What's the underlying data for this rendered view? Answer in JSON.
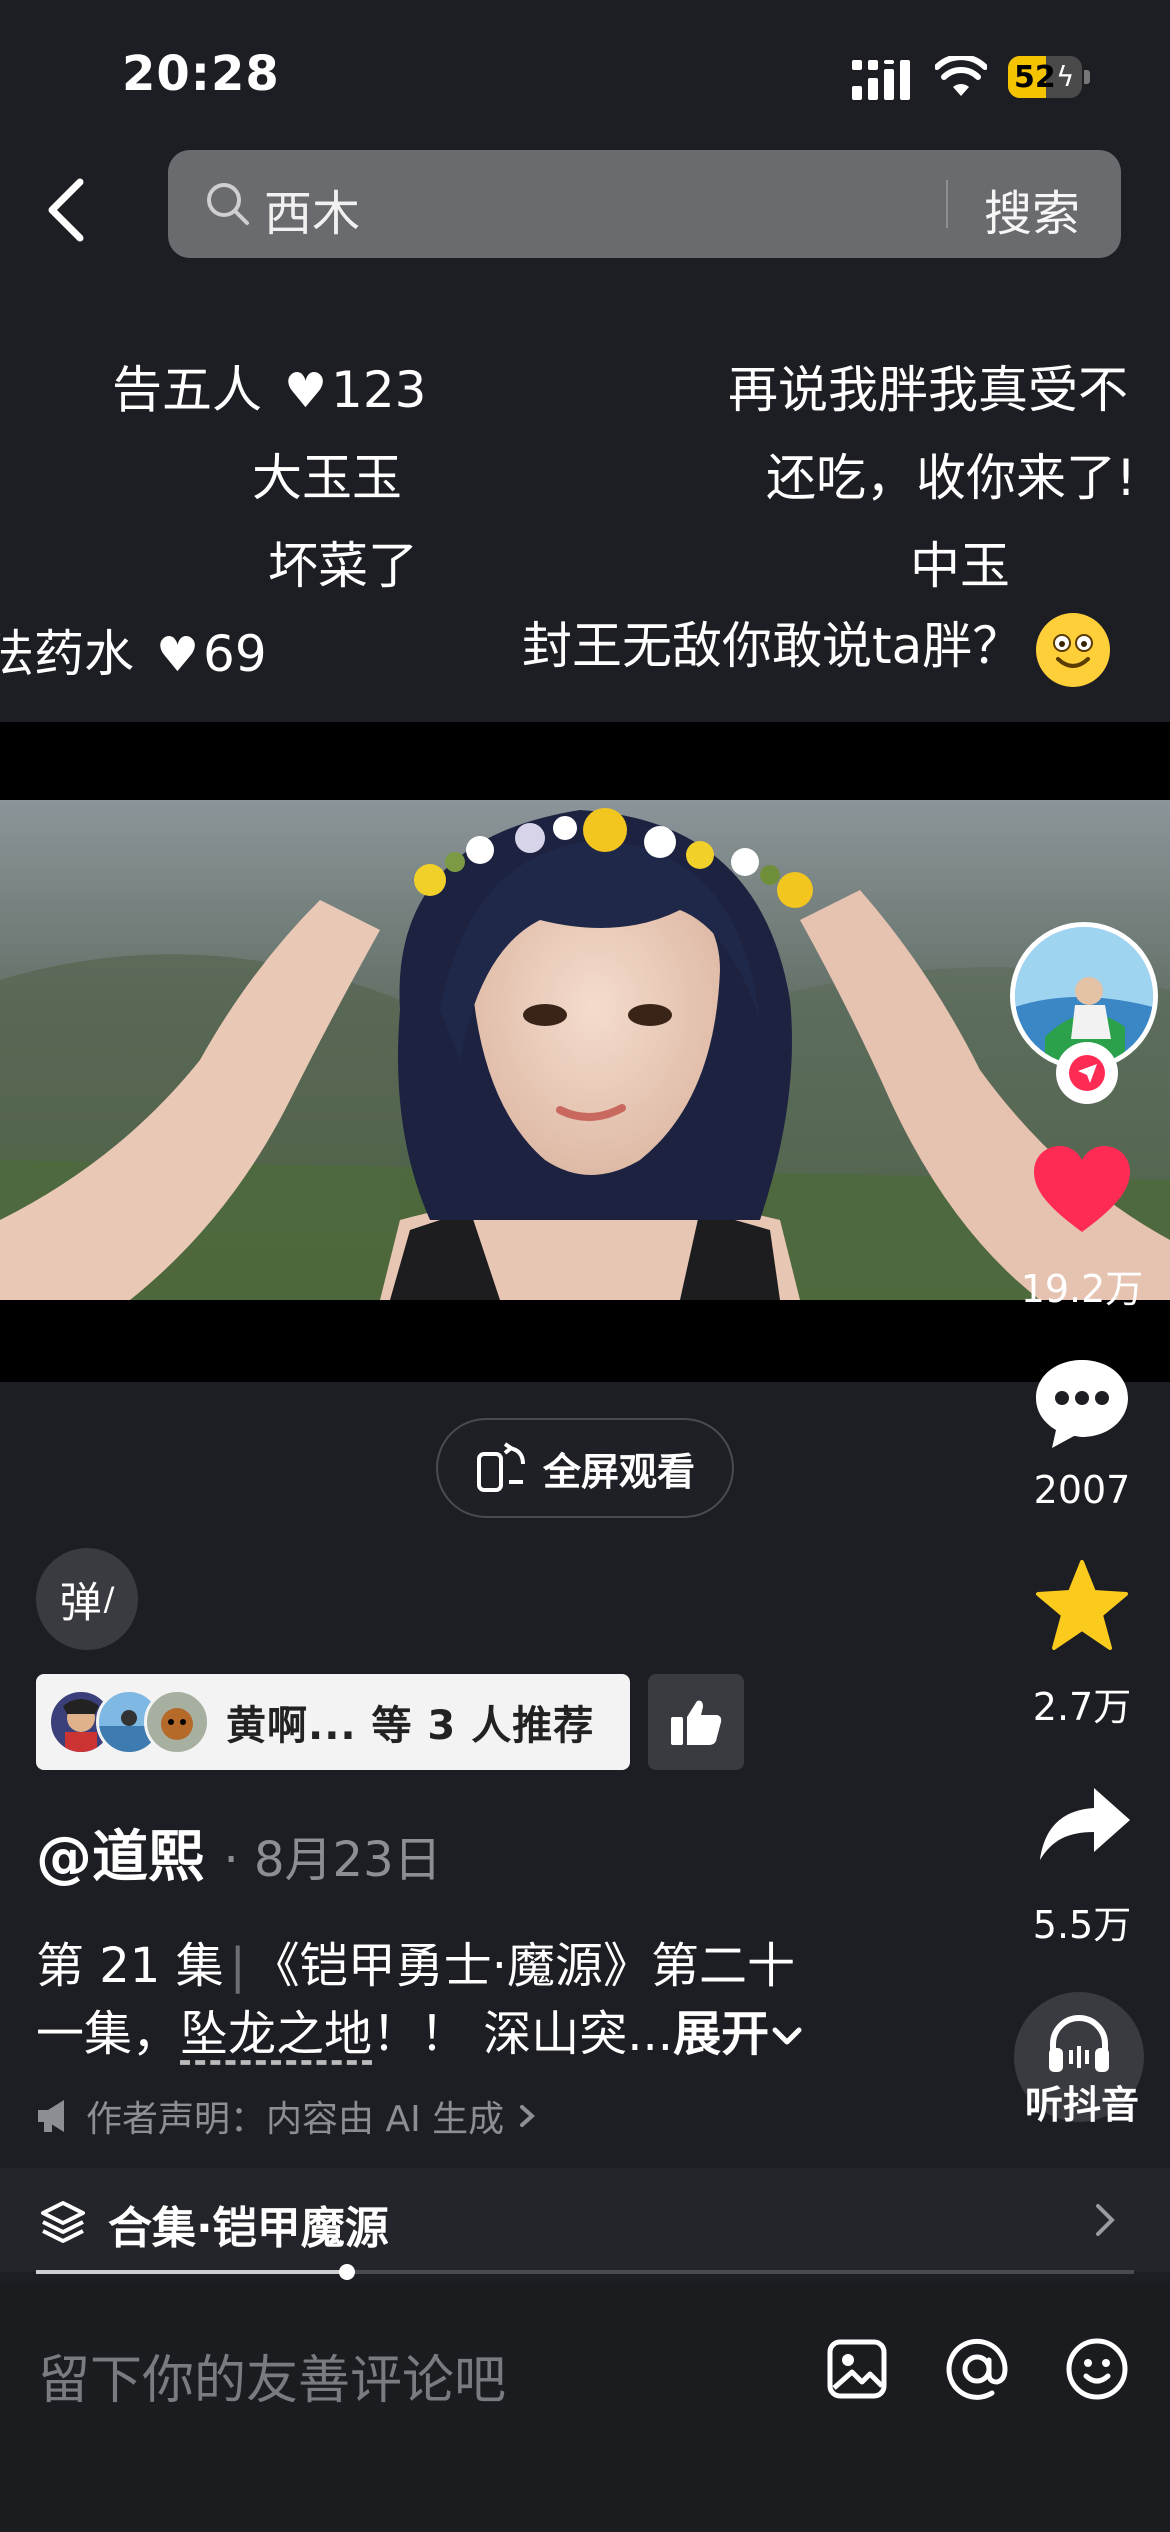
{
  "status_bar": {
    "time": "20:28",
    "battery": "52",
    "battery_level": 0.52
  },
  "search": {
    "value": "西木",
    "button_label": "搜索"
  },
  "danmaku": [
    {
      "text": "告五人",
      "likes": "123"
    },
    {
      "text": "再说我胖我真受不"
    },
    {
      "text": "大玉玉"
    },
    {
      "text": "还吃，收你来了!"
    },
    {
      "text": "坏菜了"
    },
    {
      "text": "中玉"
    },
    {
      "text": "法药水",
      "likes": "69"
    },
    {
      "text": "封王无敌你敢说ta胖？"
    }
  ],
  "rail": {
    "like_count": "19.2万",
    "comment_count": "2007",
    "favorite_count": "2.7万",
    "share_count": "5.5万",
    "listen_label": "听抖音"
  },
  "fullscreen_label": "全屏观看",
  "danmaku_toggle_label": "弹",
  "recommend": {
    "text": "黄啊... 等 3 人推荐"
  },
  "author": {
    "name": "@道熙",
    "date": "8月23日"
  },
  "description": {
    "episode": "第 21 集",
    "title_text": "《铠甲勇士·魔源》第二十",
    "line2_prefix": "一集，",
    "link_text": "坠龙之地",
    "line2_suffix": "！！ 深山突...",
    "expand_label": "展开"
  },
  "ai_note": "作者声明：内容由 AI 生成",
  "collection": {
    "label": "合集·铠甲魔源"
  },
  "progress": {
    "fraction": 0.283
  },
  "comment": {
    "placeholder": "留下你的友善评论吧"
  },
  "colors": {
    "like": "#fe2c55",
    "favorite": "#facb1c",
    "battery": "#f5c400",
    "background": "#1d1e23"
  }
}
